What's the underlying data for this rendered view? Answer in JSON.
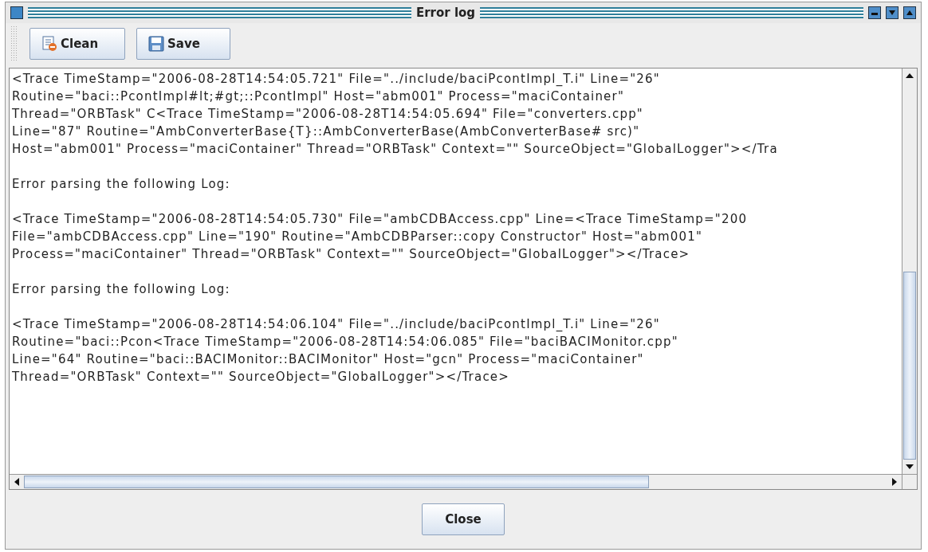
{
  "window": {
    "title": "Error log"
  },
  "toolbar": {
    "buttons": [
      {
        "label": "Clean",
        "kind": "clean"
      },
      {
        "label": "Save",
        "kind": "save"
      }
    ]
  },
  "log": {
    "paragraphs": [
      {
        "lines": [
          "<Trace TimeStamp=\"2006-08-28T14:54:05.721\" File=\"../include/baciPcontImpl_T.i\" Line=\"26\"",
          "Routine=\"baci::PcontImpl#lt;#gt;::PcontImpl\" Host=\"abm001\" Process=\"maciContainer\"",
          "Thread=\"ORBTask\" C<Trace TimeStamp=\"2006-08-28T14:54:05.694\" File=\"converters.cpp\"",
          "Line=\"87\" Routine=\"AmbConverterBase{T}::AmbConverterBase(AmbConverterBase# src)\"",
          "Host=\"abm001\" Process=\"maciContainer\" Thread=\"ORBTask\" Context=\"\" SourceObject=\"GlobalLogger\"></Tra"
        ]
      },
      {
        "lines": [
          "Error parsing the following Log:"
        ]
      },
      {
        "lines": [
          "<Trace TimeStamp=\"2006-08-28T14:54:05.730\" File=\"ambCDBAccess.cpp\" Line=<Trace TimeStamp=\"200",
          "File=\"ambCDBAccess.cpp\" Line=\"190\" Routine=\"AmbCDBParser::copy Constructor\" Host=\"abm001\"",
          "Process=\"maciContainer\" Thread=\"ORBTask\" Context=\"\" SourceObject=\"GlobalLogger\"></Trace>"
        ]
      },
      {
        "lines": [
          "Error parsing the following Log:"
        ]
      },
      {
        "lines": [
          "<Trace TimeStamp=\"2006-08-28T14:54:06.104\" File=\"../include/baciPcontImpl_T.i\" Line=\"26\"",
          "Routine=\"baci::Pcon<Trace TimeStamp=\"2006-08-28T14:54:06.085\" File=\"baciBACIMonitor.cpp\"",
          "Line=\"64\" Routine=\"baci::BACIMonitor::BACIMonitor\" Host=\"gcn\" Process=\"maciContainer\"",
          "Thread=\"ORBTask\" Context=\"\" SourceObject=\"GlobalLogger\"></Trace>"
        ]
      }
    ]
  },
  "footer": {
    "button": "Close"
  }
}
